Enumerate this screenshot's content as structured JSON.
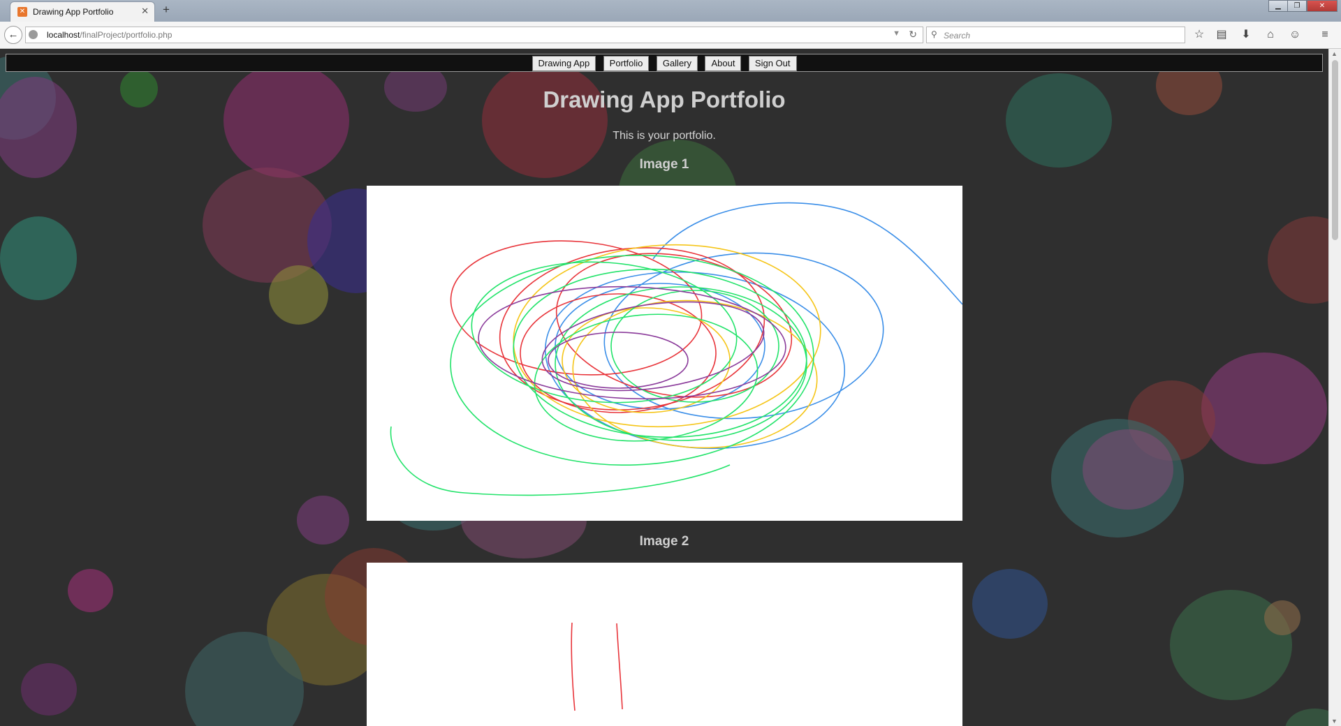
{
  "browser": {
    "tab_title": "Drawing App Portfolio",
    "url_host": "localhost",
    "url_path": "/finalProject/portfolio.php",
    "search_placeholder": "Search"
  },
  "site_nav": {
    "items": [
      "Drawing App",
      "Portfolio",
      "Gallery",
      "About",
      "Sign Out"
    ]
  },
  "page": {
    "title": "Drawing App Portfolio",
    "intro": "This is your portfolio.",
    "images": [
      {
        "heading": "Image 1"
      },
      {
        "heading": "Image 2"
      }
    ]
  },
  "colors": {
    "page_bg": "#2f2f2f",
    "nav_bg": "#111111",
    "stroke_red": "#e8343a",
    "stroke_green": "#22e36a",
    "stroke_yellow": "#f5c518",
    "stroke_blue": "#3a8ee8",
    "stroke_purple": "#8a3a9a"
  }
}
